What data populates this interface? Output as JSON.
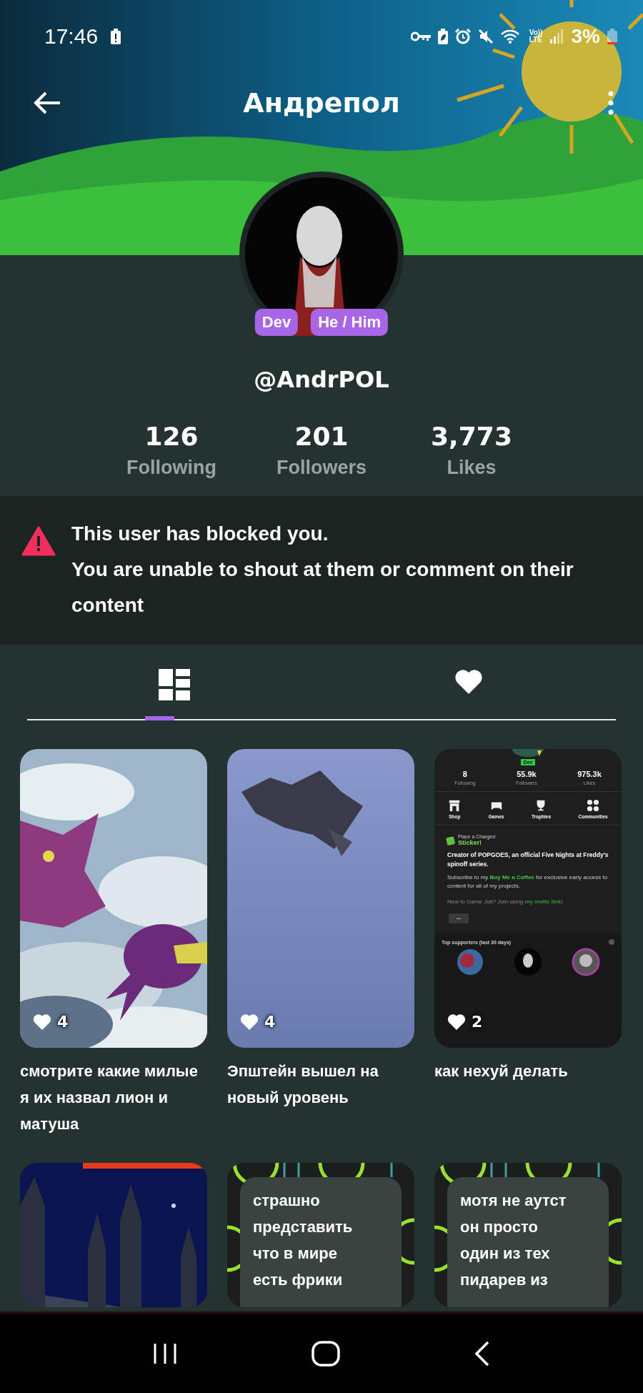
{
  "status_bar": {
    "time": "17:46",
    "network": [
      "Vo))",
      "LTE"
    ],
    "battery": "3%"
  },
  "header": {
    "title": "Андрепол"
  },
  "profile": {
    "badges": [
      "Dev",
      "He / Him"
    ],
    "handle": "@AndrPOL",
    "stats": [
      {
        "value": "126",
        "label": "Following"
      },
      {
        "value": "201",
        "label": "Followers"
      },
      {
        "value": "3,773",
        "label": "Likes"
      }
    ]
  },
  "notice": {
    "lines": [
      "This user has blocked you.",
      "You are unable to shout at them or comment on their content"
    ]
  },
  "tabs": [
    {
      "kind": "posts",
      "selected": true
    },
    {
      "kind": "likes",
      "selected": false
    }
  ],
  "posts": [
    {
      "kind": "picture",
      "likes": "4",
      "caption": "смотрите какие милые я их назвал лион и матуша"
    },
    {
      "kind": "picture",
      "likes": "4",
      "caption": "Эпштейн вышел на новый уровень"
    },
    {
      "kind": "screenshot",
      "likes": "2",
      "caption": "как нехуй делать",
      "screen": {
        "badge": "Dev",
        "stats": [
          {
            "value": "8",
            "label": "Following"
          },
          {
            "value": "55.9k",
            "label": "Followers"
          },
          {
            "value": "975.3k",
            "label": "Likes"
          }
        ],
        "actions": [
          "Shop",
          "Games",
          "Trophies",
          "Communities"
        ],
        "sticker_hint": "Place a Charged",
        "sticker": "Sticker!",
        "bio": "Creator of POPGOES, an official Five Nights at Freddy's spinoff series.",
        "subscribe_before": "Subscribe to my",
        "subscribe_link": "Buy Me a Coffee",
        "subscribe_after": "for exclusive early access to content for all of my projects.",
        "invite_before": "New to Game Jolt? Join using",
        "invite_link": "my invite link!",
        "supporters": "Top supporters (last 30 days)"
      }
    },
    {
      "kind": "picture"
    },
    {
      "kind": "text",
      "text": "страшно\nпредставить\nчто в мире\nесть фрики"
    },
    {
      "kind": "text",
      "text": "мотя не аутст\nон просто\nодин из тех\nпидарев из"
    }
  ]
}
